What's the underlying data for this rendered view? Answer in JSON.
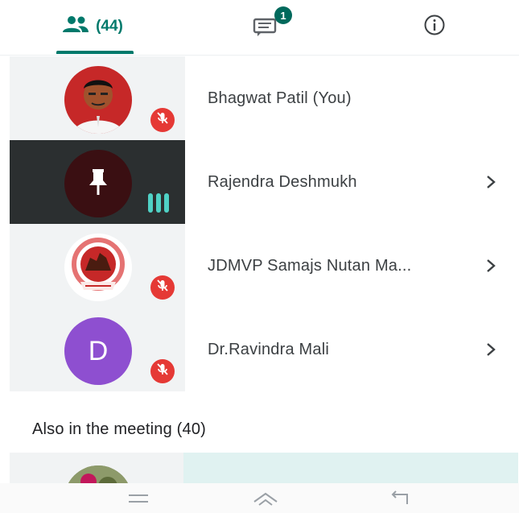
{
  "tabs": {
    "people_count": "(44)",
    "chat_badge": "1"
  },
  "participants": [
    {
      "name": "Bhagwat Patil (You)",
      "muted": true,
      "highlighted": false
    },
    {
      "name": "Rajendra Deshmukh",
      "muted": false,
      "highlighted": true
    },
    {
      "name": "JDMVP Samajs Nutan Ma...",
      "muted": true,
      "highlighted": false
    },
    {
      "name": "Dr.Ravindra Mali",
      "muted": true,
      "highlighted": false,
      "initial": "D"
    }
  ],
  "section": {
    "also_in_meeting": "Also in the meeting (40)"
  },
  "colors": {
    "accent": "#00796b",
    "mute_red": "#e53935",
    "audio_bars": "#4fd1c5",
    "avatar_purple": "#8e4fd0",
    "dark_tile": "#2b2f30"
  },
  "icons": {
    "people_tab": "people-icon",
    "chat_tab": "chat-icon",
    "info_tab": "info-icon",
    "muted": "mic-off-icon",
    "pin": "pin-icon",
    "chevron": "chevron-right-icon",
    "nav_menu": "menu-icon",
    "nav_home": "home-icon",
    "nav_back": "back-icon"
  }
}
